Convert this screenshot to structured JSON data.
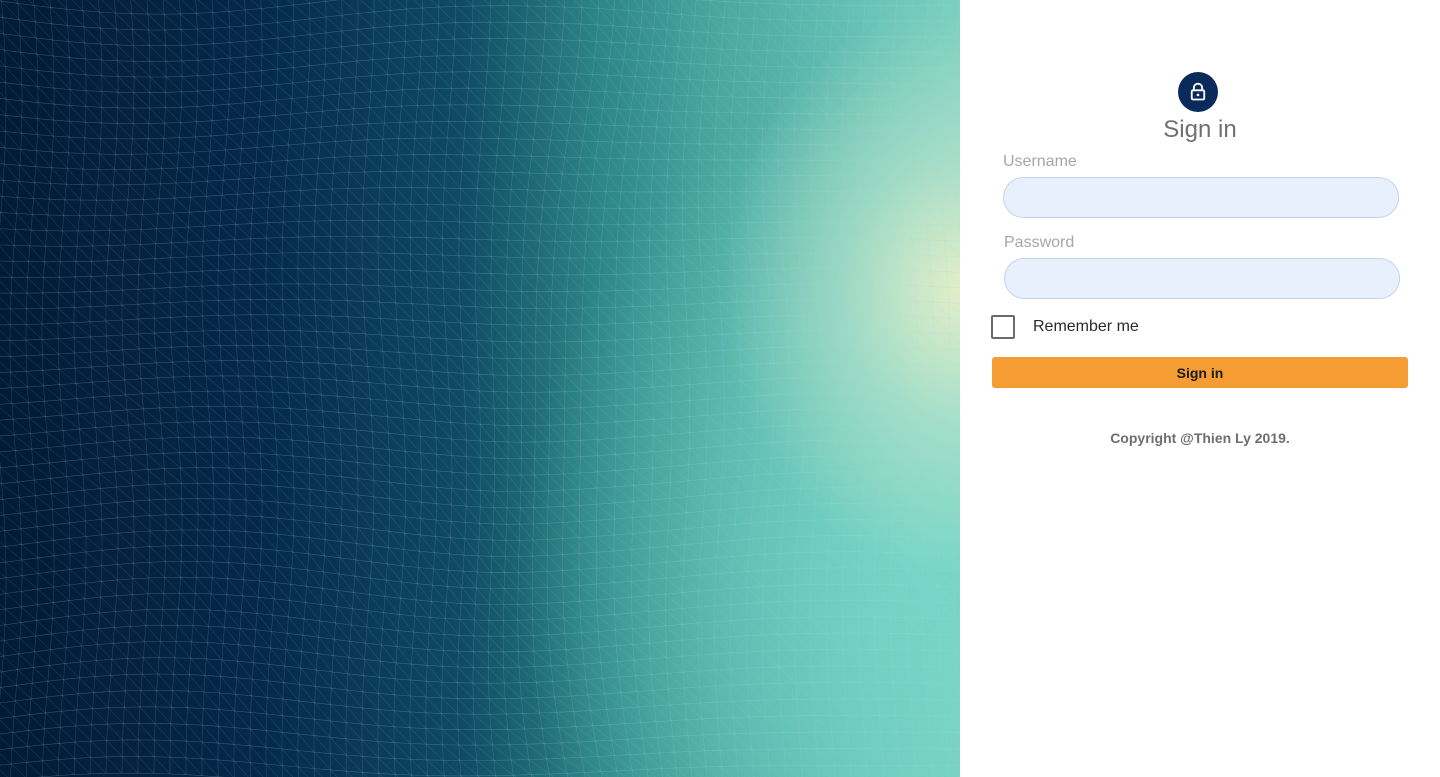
{
  "hero": {
    "icon": "wireframe-mesh-background"
  },
  "login": {
    "icon": "lock-icon",
    "title": "Sign in",
    "username_label": "Username",
    "username_value": "",
    "password_label": "Password",
    "password_value": "",
    "remember_label": "Remember me",
    "remember_checked": false,
    "submit_label": "Sign in",
    "copyright": "Copyright @Thien Ly 2019."
  },
  "colors": {
    "avatar_bg": "#0a2a5c",
    "button_bg": "#f59c33",
    "input_bg": "#e8f0fe",
    "hero_dark": "#021a35",
    "hero_light": "#7bd0c0"
  }
}
